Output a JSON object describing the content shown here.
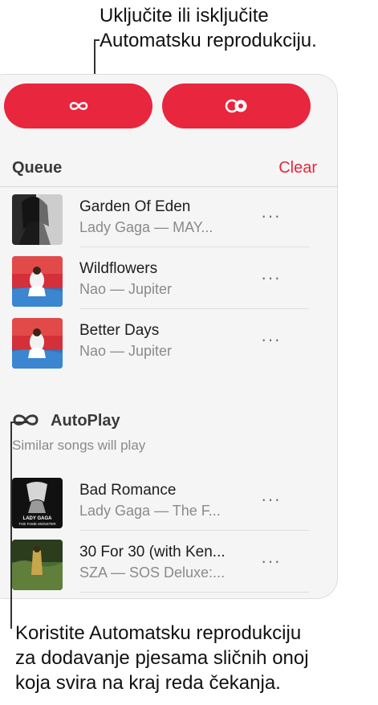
{
  "callouts": {
    "top_line1": "Uključite ili isključite",
    "top_line2": "Automatsku reprodukciju.",
    "bottom_line1": "Koristite Automatsku reprodukciju",
    "bottom_line2": "za dodavanje pjesama sličnih onoj",
    "bottom_line3": "koja svira na kraj reda čekanja."
  },
  "toggles": [
    {
      "icon": "infinity-icon"
    },
    {
      "icon": "repeat-circles-icon"
    }
  ],
  "queue": {
    "title": "Queue",
    "clear_label": "Clear",
    "tracks": [
      {
        "title": "Garden Of Eden",
        "subtitle": "Lady Gaga — MAY...",
        "more": "···"
      },
      {
        "title": "Wildflowers",
        "subtitle": "Nao — Jupiter",
        "more": "···"
      },
      {
        "title": "Better Days",
        "subtitle": "Nao — Jupiter",
        "more": "···"
      }
    ]
  },
  "autoplay": {
    "title": "AutoPlay",
    "subtitle": "Similar songs will play",
    "icon": "infinity-icon",
    "tracks": [
      {
        "title": "Bad Romance",
        "subtitle": "Lady Gaga — The F...",
        "more": "···"
      },
      {
        "title": "30 For 30 (with Ken...",
        "subtitle": "SZA — SOS Deluxe:...",
        "more": "···"
      }
    ]
  },
  "colors": {
    "accent": "#e8263e",
    "panel_bg": "#f5f5f5",
    "secondary_text": "#8a8a8e"
  }
}
